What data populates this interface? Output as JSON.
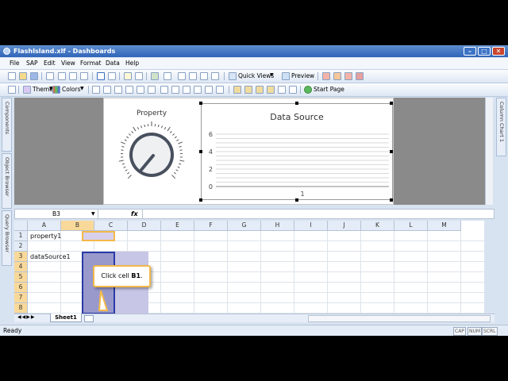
{
  "window": {
    "title": "FlashIsland.xlf - Dashboards"
  },
  "menu": [
    "File",
    "SAP",
    "Edit",
    "View",
    "Format",
    "Data",
    "Help"
  ],
  "toolbar1": {
    "quick_views": "Quick Views",
    "preview": "Preview"
  },
  "toolbar2": {
    "themes": "Themes",
    "colors": "Colors",
    "start_page": "Start Page"
  },
  "side_tabs": {
    "components": "Components",
    "object_browser": "Object Browser",
    "query_browser": "Query Browser",
    "right": "Column Chart 1"
  },
  "canvas": {
    "dial_title": "Property",
    "chart": {
      "title": "Data Source",
      "x_tick": "1",
      "y_ticks": [
        "0",
        "2",
        "4",
        "6"
      ]
    }
  },
  "chart_data": {
    "type": "bar",
    "title": "Data Source",
    "categories": [
      "1"
    ],
    "values": [
      0
    ],
    "ylim": [
      0,
      6
    ],
    "grid": true
  },
  "formula": {
    "name_box": "B3",
    "fx": "fx",
    "value": ""
  },
  "sheet": {
    "columns": [
      "A",
      "B",
      "C",
      "D",
      "E",
      "F",
      "G",
      "H",
      "I",
      "J",
      "K",
      "L",
      "M"
    ],
    "rows": [
      "1",
      "2",
      "3",
      "4",
      "5",
      "6",
      "7",
      "8"
    ],
    "cells": {
      "A1": "property1",
      "A3": "dataSource1"
    },
    "tab": "Sheet1"
  },
  "callout": {
    "text_prefix": "Click cell ",
    "cell": "B1",
    "suffix": "."
  },
  "status": {
    "text": "Ready",
    "indicators": [
      "CAP",
      "NUM",
      "SCRL"
    ]
  },
  "colors": {
    "title_bar": "#2f64b8",
    "selection": "#9999cc",
    "highlight": "#f3b94a"
  }
}
